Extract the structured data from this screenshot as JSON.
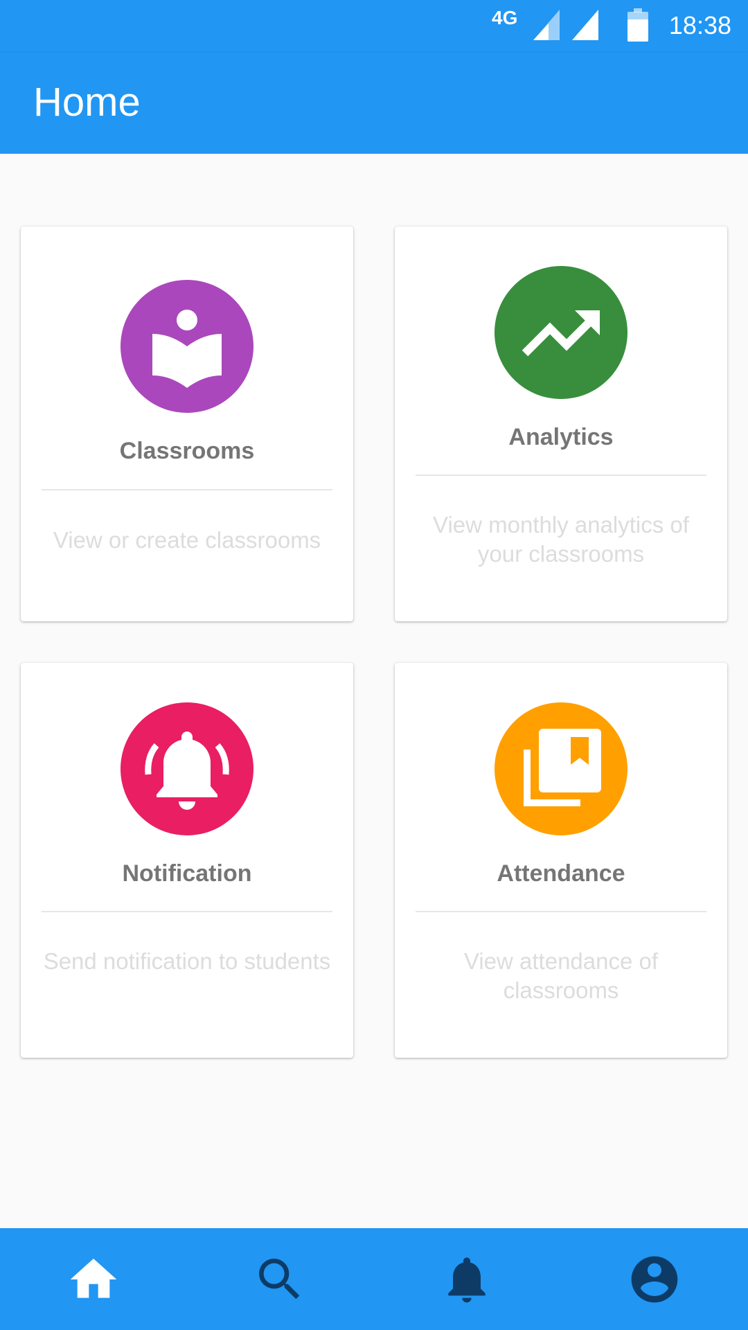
{
  "status_bar": {
    "network": "4G",
    "time": "18:38"
  },
  "app_bar": {
    "title": "Home"
  },
  "cards": [
    {
      "title": "Classrooms",
      "description": "View or create classrooms",
      "icon": "classroom-book-icon",
      "color": "#ab47bc"
    },
    {
      "title": "Analytics",
      "description": "View monthly analytics of your classrooms",
      "icon": "trending-up-icon",
      "color": "#388e3c"
    },
    {
      "title": "Notification",
      "description": "Send notification to students",
      "icon": "bell-ringing-icon",
      "color": "#e91e63"
    },
    {
      "title": "Attendance",
      "description": "View attendance of classrooms",
      "icon": "library-books-icon",
      "color": "#ffa000"
    }
  ],
  "bottom_nav": {
    "items": [
      {
        "icon": "home-icon",
        "active": true
      },
      {
        "icon": "search-icon",
        "active": false
      },
      {
        "icon": "notifications-icon",
        "active": false
      },
      {
        "icon": "account-circle-icon",
        "active": false
      }
    ],
    "active_color": "#ffffff",
    "inactive_color": "#0d3b66"
  },
  "colors": {
    "primary": "#2196f3",
    "background": "#fafafa"
  }
}
